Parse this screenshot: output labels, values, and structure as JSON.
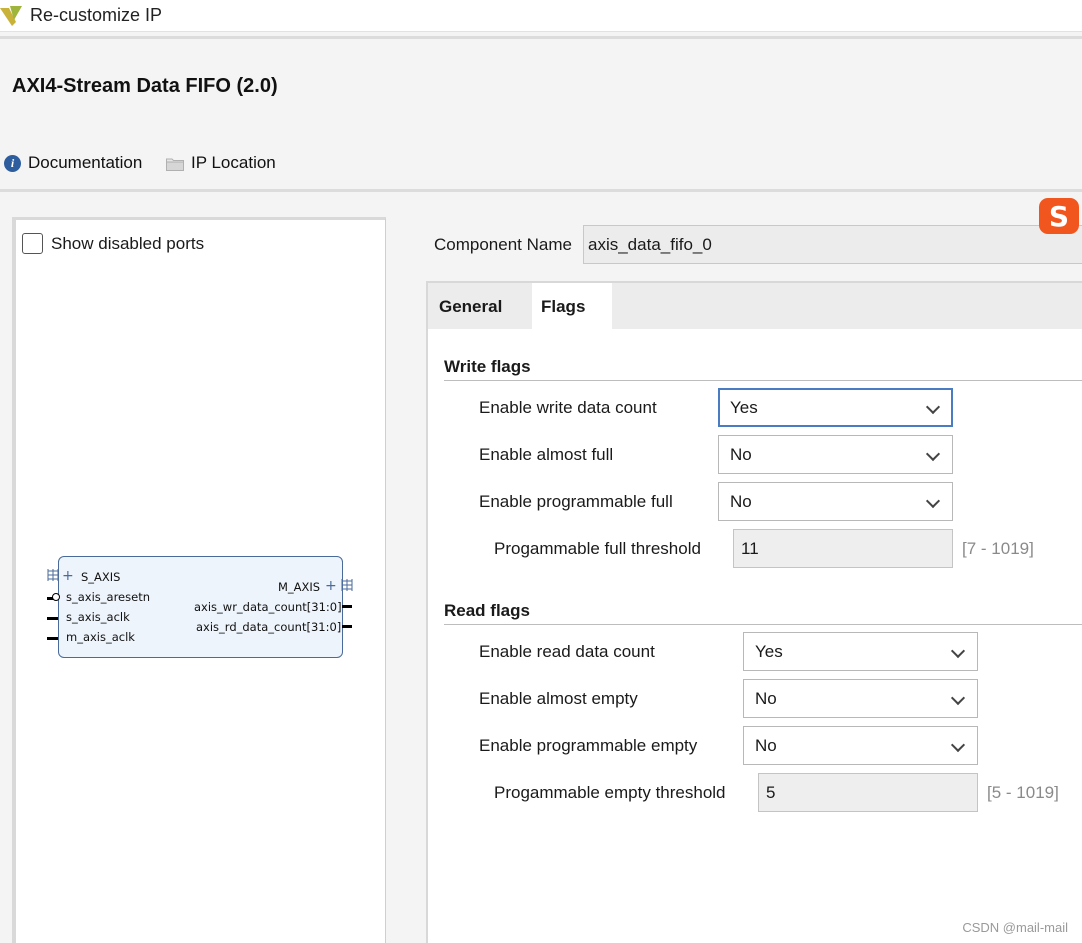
{
  "window": {
    "title": "Re-customize IP"
  },
  "ip": {
    "name": "AXI4-Stream Data FIFO (2.0)"
  },
  "toolbar": {
    "documentation": "Documentation",
    "ip_location": "IP Location"
  },
  "left_panel": {
    "show_disabled_ports": "Show disabled ports",
    "block": {
      "s_axis": "S_AXIS",
      "s_axis_aresetn": "s_axis_aresetn",
      "s_axis_aclk": "s_axis_aclk",
      "m_axis_aclk": "m_axis_aclk",
      "m_axis": "M_AXIS",
      "wr_count": "axis_wr_data_count[31:0]",
      "rd_count": "axis_rd_data_count[31:0]"
    }
  },
  "component": {
    "label": "Component Name",
    "value": "axis_data_fifo_0"
  },
  "tabs": [
    {
      "label": "General"
    },
    {
      "label": "Flags"
    }
  ],
  "write_flags": {
    "title": "Write flags",
    "enable_write_data_count": {
      "label": "Enable write data count",
      "value": "Yes"
    },
    "enable_almost_full": {
      "label": "Enable almost full",
      "value": "No"
    },
    "enable_programmable_full": {
      "label": "Enable programmable full",
      "value": "No"
    },
    "full_threshold": {
      "label": "Progammable full threshold",
      "value": "11",
      "range": "[7 - 1019]"
    }
  },
  "read_flags": {
    "title": "Read flags",
    "enable_read_data_count": {
      "label": "Enable read data count",
      "value": "Yes"
    },
    "enable_almost_empty": {
      "label": "Enable almost empty",
      "value": "No"
    },
    "enable_programmable_empty": {
      "label": "Enable programmable empty",
      "value": "No"
    },
    "empty_threshold": {
      "label": "Progammable empty threshold",
      "value": "5",
      "range": "[5 - 1019]"
    }
  },
  "watermark": "CSDN @mail-mail",
  "colors": {
    "accent": "#4a7cc4",
    "info_icon": "#2e5d9e",
    "block_border": "#4a6a9a",
    "block_fill": "#eef4fb"
  }
}
